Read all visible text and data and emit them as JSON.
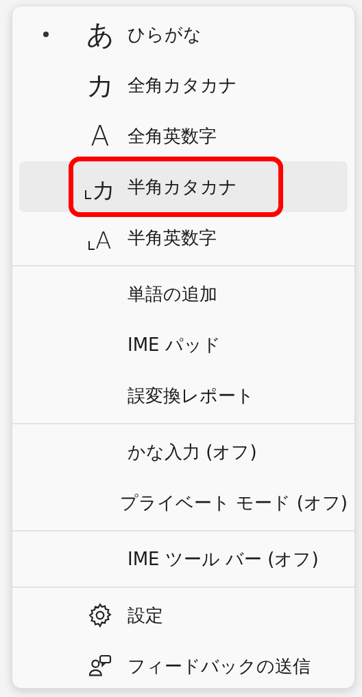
{
  "menu": {
    "sections": [
      {
        "items": [
          {
            "kind": "mode",
            "icon": "あ",
            "label": "ひらがな",
            "selected": true,
            "hovered": false,
            "highlighted": false
          },
          {
            "kind": "mode",
            "icon": "カ",
            "label": "全角カタカナ",
            "selected": false,
            "hovered": false,
            "highlighted": false
          },
          {
            "kind": "mode",
            "icon": "A",
            "label": "全角英数字",
            "selected": false,
            "hovered": false,
            "highlighted": false
          },
          {
            "kind": "halfmode",
            "icon": "カ",
            "label": "半角カタカナ",
            "selected": false,
            "hovered": true,
            "highlighted": true
          },
          {
            "kind": "halfmode",
            "icon": "A",
            "label": "半角英数字",
            "selected": false,
            "hovered": false,
            "highlighted": false
          }
        ]
      },
      {
        "items": [
          {
            "kind": "plain",
            "label": "単語の追加"
          },
          {
            "kind": "plain",
            "label": "IME パッド"
          },
          {
            "kind": "plain",
            "label": "誤変換レポート"
          }
        ]
      },
      {
        "items": [
          {
            "kind": "plain",
            "label": "かな入力 (オフ)"
          },
          {
            "kind": "plain",
            "label": "プライベート モード (オフ)"
          }
        ]
      },
      {
        "items": [
          {
            "kind": "plain",
            "label": "IME ツール バー (オフ)"
          }
        ]
      },
      {
        "items": [
          {
            "kind": "settings",
            "label": "設定"
          },
          {
            "kind": "feedback",
            "label": "フィードバックの送信"
          }
        ]
      }
    ]
  }
}
